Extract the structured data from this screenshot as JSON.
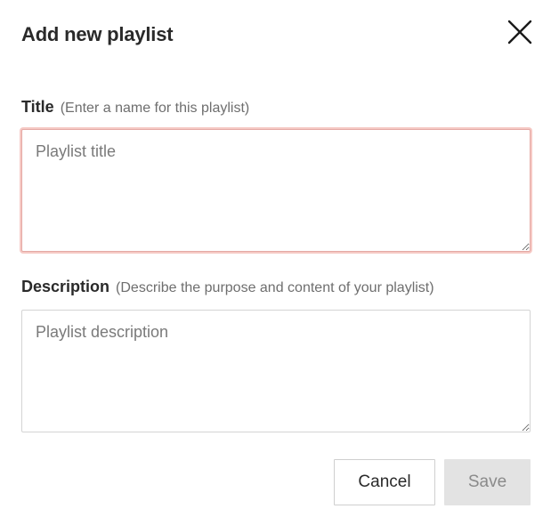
{
  "dialog": {
    "title": "Add new playlist",
    "close_icon": "close-icon"
  },
  "fields": {
    "title": {
      "label": "Title",
      "hint": "(Enter a name for this playlist)",
      "placeholder": "Playlist title",
      "value": ""
    },
    "description": {
      "label": "Description",
      "hint": "(Describe the purpose and content of your playlist)",
      "placeholder": "Playlist description",
      "value": ""
    }
  },
  "actions": {
    "cancel_label": "Cancel",
    "save_label": "Save",
    "save_disabled": true
  },
  "colors": {
    "focus_ring": "#f6c9c5",
    "disabled_button_bg": "#e3e3e3",
    "text": "#2a2a2a"
  }
}
